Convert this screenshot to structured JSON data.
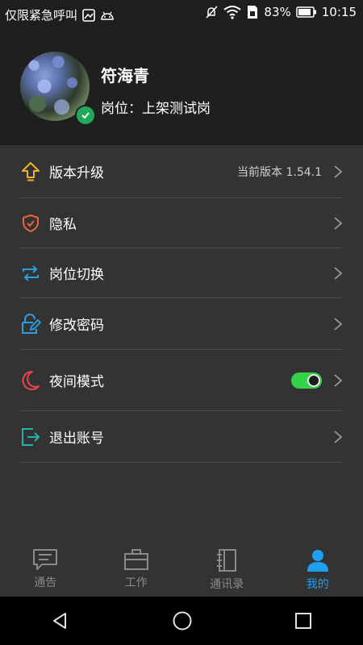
{
  "status_bar": {
    "carrier": "仅限紧急呼叫",
    "battery": "83%",
    "time": "10:15"
  },
  "profile": {
    "name": "符海青",
    "role": "岗位：上架测试岗"
  },
  "menu": {
    "items": [
      {
        "label": "版本升级",
        "extra": "当前版本 1.54.1",
        "icon": "upgrade-arrow-icon"
      },
      {
        "label": "隐私",
        "icon": "shield-check-icon"
      },
      {
        "label": "岗位切换",
        "icon": "switch-arrows-icon"
      },
      {
        "label": "修改密码",
        "icon": "lock-edit-icon"
      },
      {
        "label": "夜间模式",
        "icon": "moon-icon",
        "toggle": true
      },
      {
        "label": "退出账号",
        "icon": "logout-icon"
      }
    ]
  },
  "tabs": [
    {
      "label": "通告",
      "icon": "message-icon"
    },
    {
      "label": "工作",
      "icon": "briefcase-icon"
    },
    {
      "label": "通讯录",
      "icon": "contacts-book-icon"
    },
    {
      "label": "我的",
      "icon": "person-icon",
      "active": true
    }
  ],
  "colors": {
    "accent": "#1ea0f0",
    "toggle_on": "#33d34c",
    "menu_bg": "#333333",
    "header_bg": "#1f1f1f"
  }
}
